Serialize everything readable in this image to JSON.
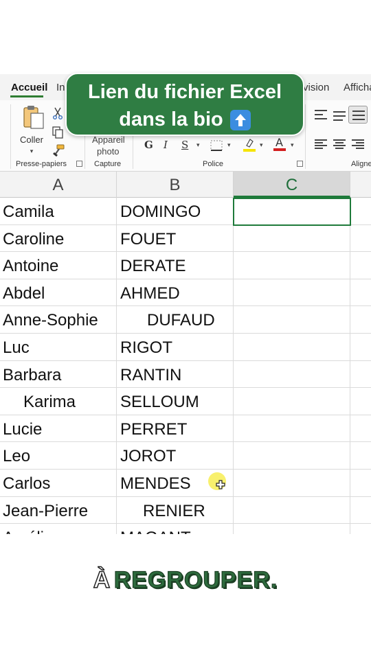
{
  "ribbon": {
    "tabs": [
      {
        "label": "Accueil",
        "active": true
      },
      {
        "label": "In",
        "active": false
      },
      {
        "label": "vision",
        "active": false
      },
      {
        "label": "Afficha",
        "active": false
      }
    ],
    "clipboard": {
      "paste_label": "Coller",
      "group_label": "Presse-papiers"
    },
    "capture": {
      "button_line1": "Appareil",
      "button_line2": "photo",
      "group_label": "Capture"
    },
    "font": {
      "bold": "G",
      "italic": "I",
      "underline": "S",
      "group_label": "Police",
      "highlight_color": "#f5e400",
      "font_color": "#d31f1f"
    },
    "alignment": {
      "group_label": "Aligne"
    }
  },
  "banner": {
    "line1": "Lien du fichier Excel",
    "line2": "dans la bio",
    "icon": "up-arrow-icon",
    "background": "#2f7d43"
  },
  "sheet": {
    "columns": [
      "A",
      "B",
      "C"
    ],
    "selected_column": "C",
    "rows": [
      {
        "a": "Camila",
        "b": "DOMINGO"
      },
      {
        "a": "Caroline",
        "b": "FOUET"
      },
      {
        "a": "Antoine",
        "b": "DERATE"
      },
      {
        "a": "Abdel",
        "b": "AHMED"
      },
      {
        "a": "Anne-Sophie",
        "b": "DUFAUD"
      },
      {
        "a": "Luc",
        "b": "RIGOT"
      },
      {
        "a": "Barbara",
        "b": "RANTIN"
      },
      {
        "a": "Karima",
        "b": "SELLOUM"
      },
      {
        "a": "Lucie",
        "b": "PERRET"
      },
      {
        "a": "Leo",
        "b": "JOROT"
      },
      {
        "a": "Carlos",
        "b": "MENDES"
      },
      {
        "a": "Jean-Pierre",
        "b": "RENIER"
      },
      {
        "a": "Amélie",
        "b": "MAGANT"
      }
    ],
    "accent": "#1e7a3a"
  },
  "logo": {
    "prefix": "À",
    "word": "REGROUPER."
  }
}
